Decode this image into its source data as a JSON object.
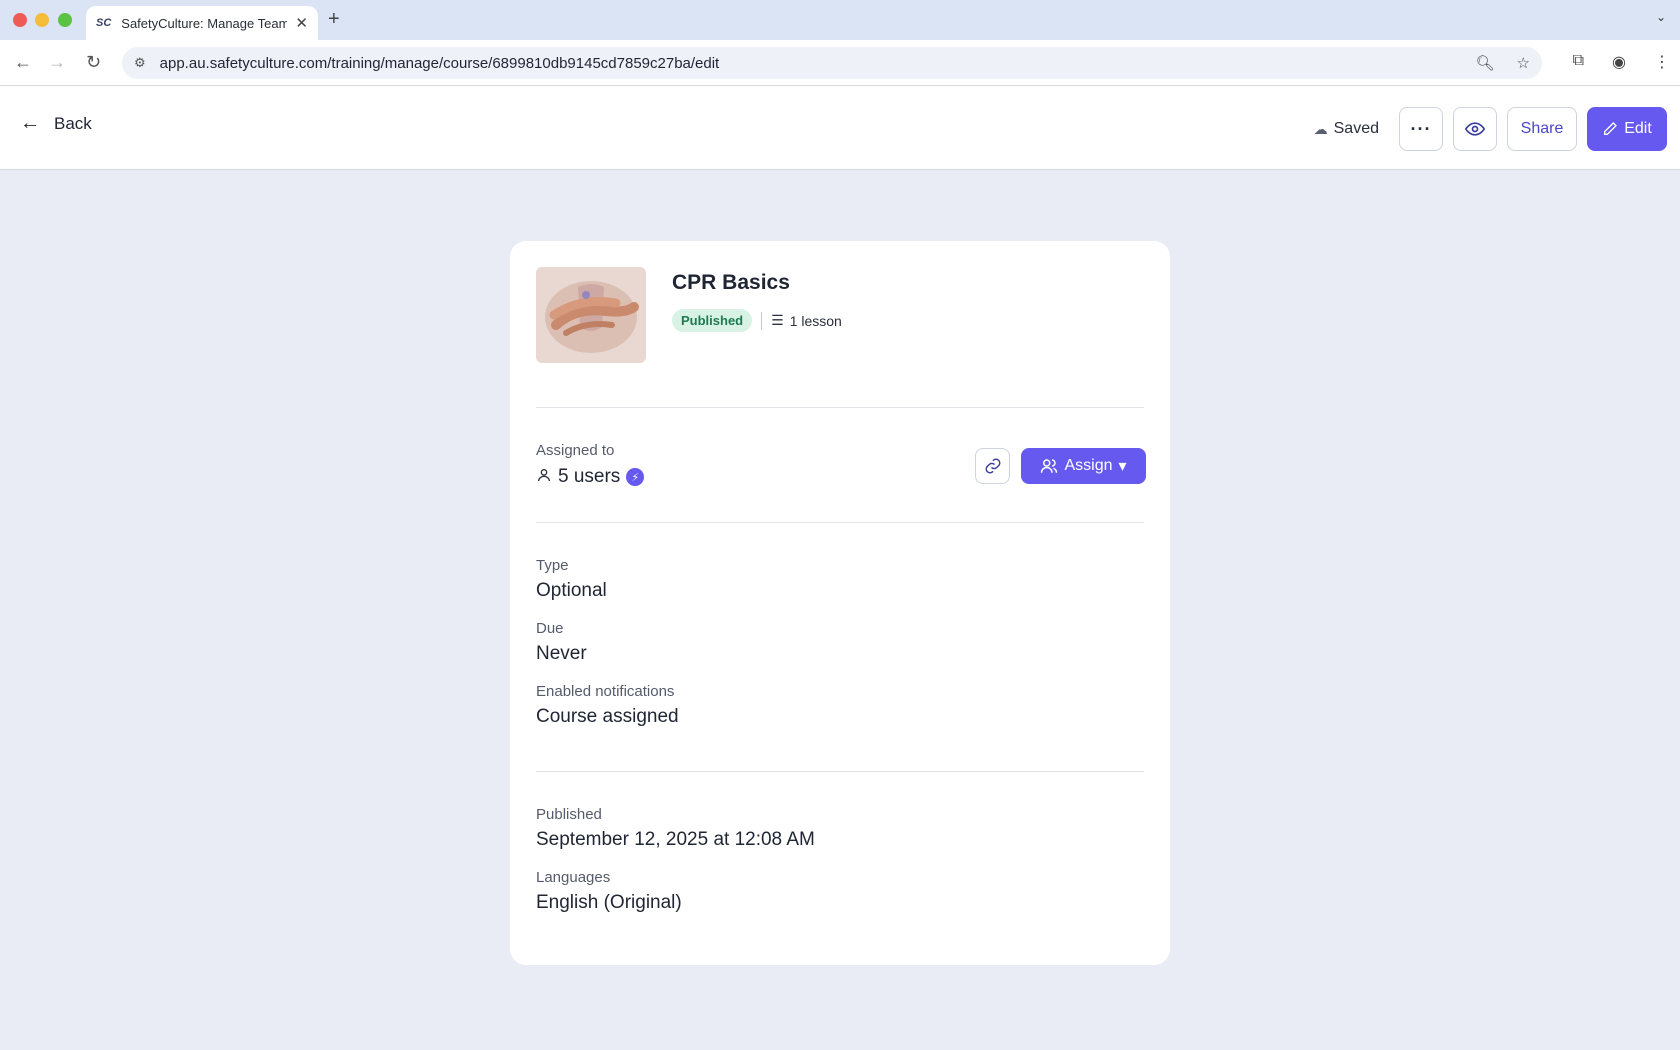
{
  "browser": {
    "tab_favicon": "SC",
    "tab_title": "SafetyCulture: Manage Teams",
    "url": "app.au.safetyculture.com/training/manage/course/6899810db9145cd7859c27ba/edit"
  },
  "header": {
    "back_label": "Back",
    "saved_label": "Saved",
    "share_label": "Share",
    "edit_label": "Edit"
  },
  "course": {
    "title": "CPR Basics",
    "status": "Published",
    "lessons": "1 lesson"
  },
  "assignment": {
    "label": "Assigned to",
    "users": "5 users",
    "assign_label": "Assign"
  },
  "details": {
    "type_label": "Type",
    "type_value": "Optional",
    "due_label": "Due",
    "due_value": "Never",
    "notifications_label": "Enabled notifications",
    "notifications_value": "Course assigned",
    "published_label": "Published",
    "published_value": "September 12, 2025 at 12:08 AM",
    "languages_label": "Languages",
    "languages_value": "English (Original)"
  },
  "colors": {
    "accent": "#6559f0",
    "published_badge_bg": "#d8f3e6",
    "published_badge_text": "#1f7a4f",
    "page_bg": "#e9ebf5"
  }
}
